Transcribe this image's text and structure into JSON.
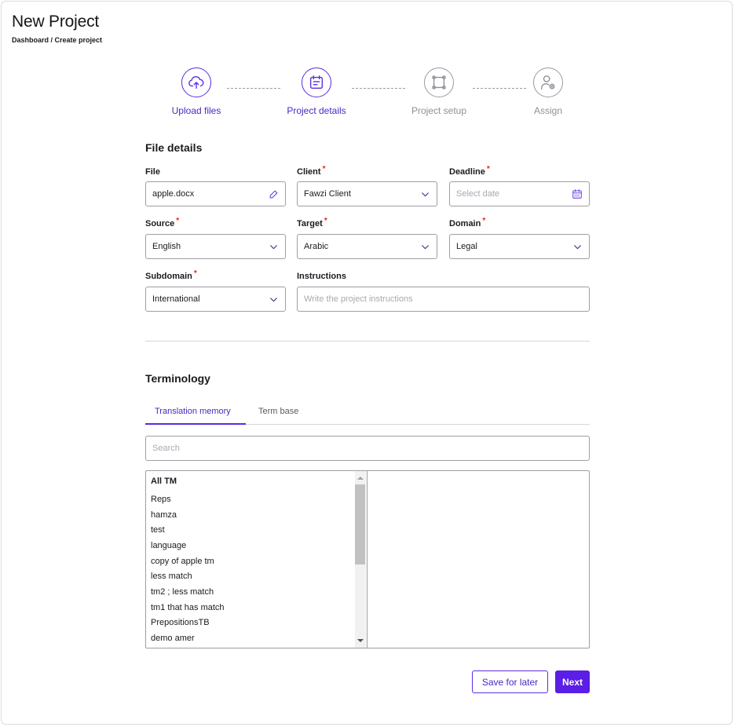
{
  "header": {
    "title": "New Project",
    "breadcrumb": "Dashboard / Create project"
  },
  "stepper": {
    "steps": [
      {
        "label": "Upload files",
        "icon": "cloud-upload-icon",
        "state": "active"
      },
      {
        "label": "Project details",
        "icon": "calendar-note-icon",
        "state": "active"
      },
      {
        "label": "Project setup",
        "icon": "frame-icon",
        "state": "inactive"
      },
      {
        "label": "Assign",
        "icon": "user-settings-icon",
        "state": "inactive"
      }
    ]
  },
  "file_details": {
    "title": "File details",
    "file": {
      "label": "File",
      "value": "apple.docx"
    },
    "client": {
      "label": "Client",
      "value": "Fawzi Client"
    },
    "deadline": {
      "label": "Deadline",
      "placeholder": "Select date"
    },
    "source": {
      "label": "Source",
      "value": "English"
    },
    "target": {
      "label": "Target",
      "value": "Arabic"
    },
    "domain": {
      "label": "Domain",
      "value": "Legal"
    },
    "subdomain": {
      "label": "Subdomain",
      "value": "International"
    },
    "instructions": {
      "label": "Instructions",
      "placeholder": "Write the project instructions"
    },
    "required_mark": "*"
  },
  "terminology": {
    "title": "Terminology",
    "tabs": [
      {
        "label": "Translation memory",
        "active": true
      },
      {
        "label": "Term base",
        "active": false
      }
    ],
    "search_placeholder": "Search",
    "list_header": "All TM",
    "items": [
      "Reps",
      "hamza",
      "test",
      "language",
      "copy of apple tm",
      "less match",
      "tm2 ; less match",
      "tm1 that has match",
      "PrepositionsTB",
      "demo amer"
    ]
  },
  "actions": {
    "save_label": "Save for later",
    "next_label": "Next"
  },
  "colors": {
    "accent": "#5b2be0",
    "required": "#e0261e"
  }
}
